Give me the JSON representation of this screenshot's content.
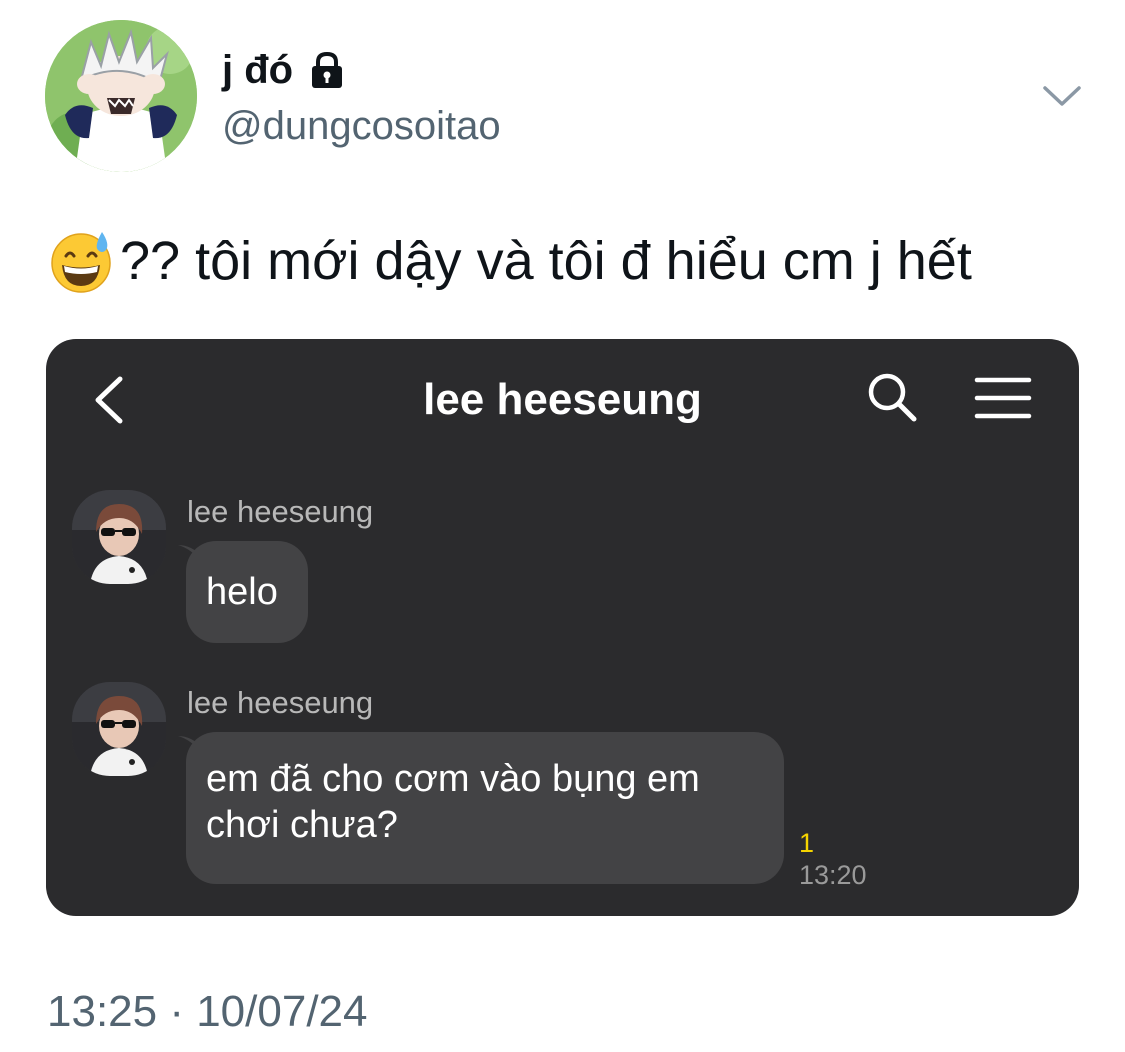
{
  "tweet": {
    "display_name": "j đó",
    "handle": "@dungcosoitao",
    "text": "?? tôi mới dậy và tôi đ hiểu cm j hết",
    "timestamp": "13:25 · 10/07/24",
    "icons": {
      "lock": "lock-icon",
      "more": "chevron-down-icon",
      "emoji": "grinning-face-with-sweat-emoji"
    }
  },
  "chat": {
    "title": "lee heeseung",
    "background_color": "#2b2b2d",
    "bubble_color": "#434345",
    "icons": {
      "back": "chevron-left-icon",
      "search": "search-icon",
      "menu": "menu-icon"
    },
    "messages": [
      {
        "sender": "lee heeseung",
        "text": "helo"
      },
      {
        "sender": "lee heeseung",
        "text": "em đã cho cơm vào bụng em chơi chưa?",
        "unread": "1",
        "time": "13:20"
      }
    ]
  },
  "colors": {
    "secondary_text": "#536471",
    "unread_badge": "#f5d400"
  }
}
